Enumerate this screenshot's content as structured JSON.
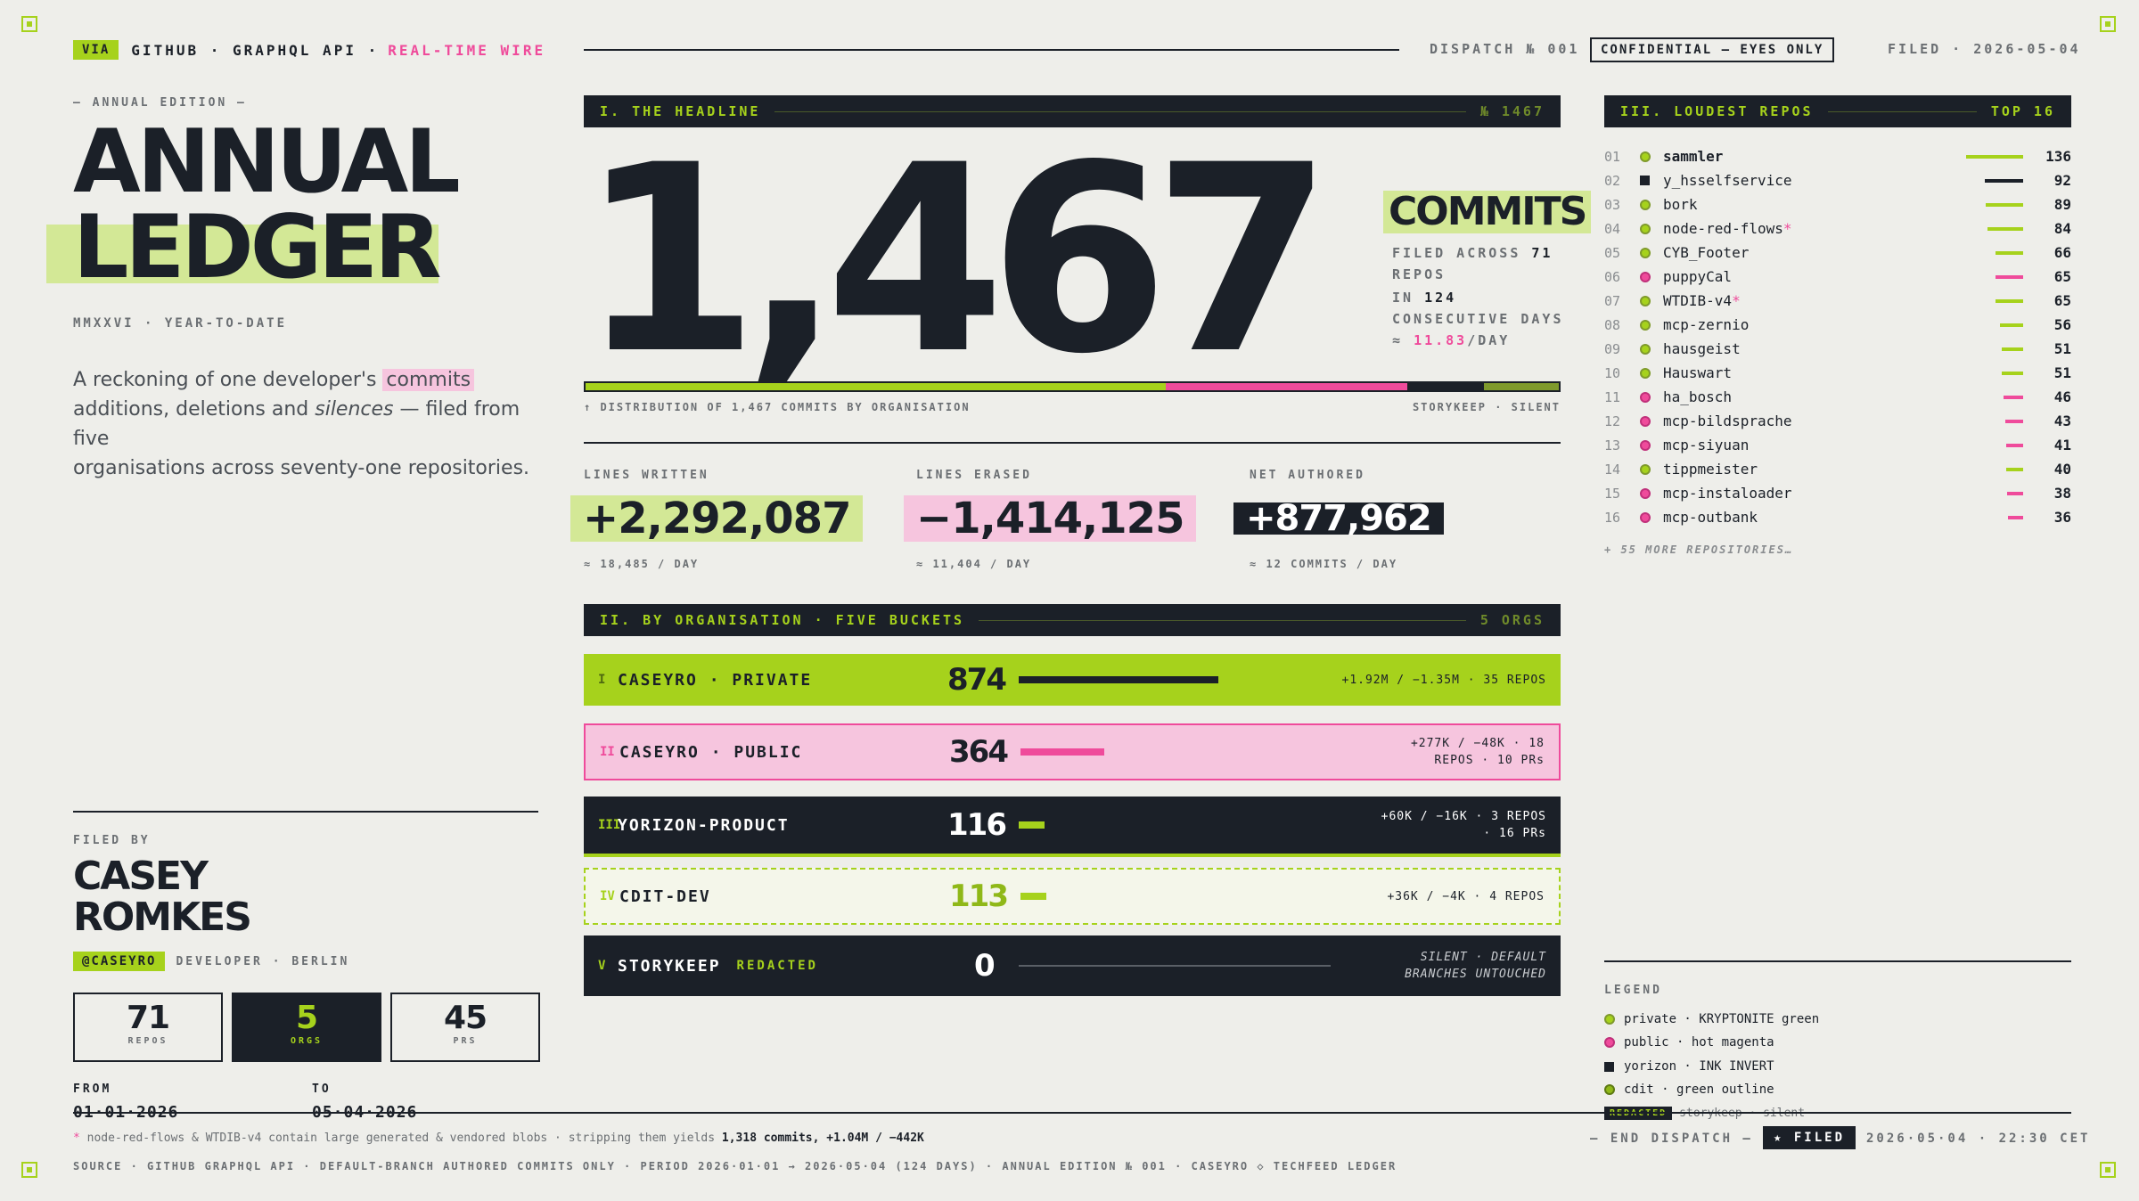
{
  "masthead": {
    "via": "VIA",
    "source": "GITHUB · GRAPHQL API ·",
    "wire": "REAL-TIME WIRE",
    "dispatch": "DISPATCH № 001",
    "confidential": "CONFIDENTIAL — EYES ONLY",
    "filed": "FILED · 2026-05-04"
  },
  "left": {
    "edition": "— ANNUAL EDITION —",
    "title_line1": "ANNUAL",
    "title_line2": "LEDGER",
    "subtitle": "MMXXVI · YEAR-TO-DATE",
    "intro_a": "A reckoning of one developer's",
    "intro_highlight": "commits",
    "intro_b": "additions, deletions and",
    "intro_em": "silences",
    "intro_c": "— filed from five",
    "intro_d": "organisations across seventy-one repositories.",
    "filed_by_label": "FILED BY",
    "name_line1": "CASEY",
    "name_line2": "ROMKES",
    "handle": "@CASEYRO",
    "role": "DEVELOPER · BERLIN",
    "stats": [
      {
        "n": "71",
        "l": "REPOS"
      },
      {
        "n": "5",
        "l": "ORGS"
      },
      {
        "n": "45",
        "l": "PRS"
      }
    ],
    "from_label": "FROM",
    "from_value": "01·01·2026",
    "to_label": "TO",
    "to_value": "05·04·2026"
  },
  "headline": {
    "section": "I. THE HEADLINE",
    "num": "№ 1467",
    "big": "1,467",
    "unit": "COMMITS",
    "filed_across_a": "FILED ACROSS",
    "filed_across_b": "71",
    "filed_across_c": "REPOS",
    "in_a": "IN",
    "in_b": "124",
    "in_c": "CONSECUTIVE DAYS",
    "rate_a": "≈",
    "rate_b": "11.83",
    "rate_c": "/DAY",
    "distribution_caption": "↑ DISTRIBUTION OF 1,467 COMMITS BY ORGANISATION",
    "distribution_right": "STORYKEEP · SILENT",
    "distribution": [
      {
        "org": "caseyro-private",
        "commits": 874,
        "color": "#a6d21c"
      },
      {
        "org": "caseyro-public",
        "commits": 364,
        "color": "#ef4b9b"
      },
      {
        "org": "yorizon-product",
        "commits": 116,
        "color": "#1b2028"
      },
      {
        "org": "cdit-dev",
        "commits": 113,
        "color": "#7f9a2c"
      }
    ]
  },
  "lines": {
    "written_label": "LINES WRITTEN",
    "written_value": "+2,292,087",
    "written_rate": "≈ 18,485 / DAY",
    "erased_label": "LINES ERASED",
    "erased_value": "−1,414,125",
    "erased_rate": "≈ 11,404 / DAY",
    "net_label": "NET AUTHORED",
    "net_value": "+877,962",
    "net_rate": "≈ 12 COMMITS / DAY"
  },
  "orgs": {
    "section": "II. BY ORGANISATION · FIVE BUCKETS",
    "count": "5 ORGS",
    "rows": [
      {
        "roman": "I",
        "name": "CASEYRO · PRIVATE",
        "tag": "",
        "commits": "874",
        "fill": 1.0,
        "meta": "+1.92M / −1.35M · 35 REPOS"
      },
      {
        "roman": "II",
        "name": "CASEYRO · PUBLIC",
        "tag": "",
        "commits": "364",
        "fill": 0.42,
        "meta": "+277K / −48K · 18 REPOS · 10 PRs"
      },
      {
        "roman": "III",
        "name": "YORIZON-PRODUCT",
        "tag": "",
        "commits": "116",
        "fill": 0.13,
        "meta": "+60K / −16K · 3 REPOS · 16 PRs"
      },
      {
        "roman": "IV",
        "name": "CDIT-DEV",
        "tag": "",
        "commits": "113",
        "fill": 0.13,
        "meta": "+36K / −4K · 4 REPOS"
      },
      {
        "roman": "V",
        "name": "STORYKEEP",
        "tag": "REDACTED",
        "commits": "0",
        "fill": 0,
        "meta": "SILENT · DEFAULT BRANCHES UNTOUCHED"
      }
    ]
  },
  "repos": {
    "section": "III. LOUDEST REPOS",
    "top": "TOP 16",
    "items": [
      {
        "idx": "01",
        "name": "sammler",
        "star": "",
        "kind": "private",
        "value": 136
      },
      {
        "idx": "02",
        "name": "y_hsselfservice",
        "star": "",
        "kind": "yorizon",
        "value": 92
      },
      {
        "idx": "03",
        "name": "bork",
        "star": "",
        "kind": "private",
        "value": 89
      },
      {
        "idx": "04",
        "name": "node-red-flows",
        "star": "*",
        "kind": "private",
        "value": 84
      },
      {
        "idx": "05",
        "name": "CYB_Footer",
        "star": "",
        "kind": "private",
        "value": 66
      },
      {
        "idx": "06",
        "name": "puppyCal",
        "star": "",
        "kind": "public",
        "value": 65
      },
      {
        "idx": "07",
        "name": "WTDIB-v4",
        "star": "*",
        "kind": "private",
        "value": 65
      },
      {
        "idx": "08",
        "name": "mcp-zernio",
        "star": "",
        "kind": "private",
        "value": 56
      },
      {
        "idx": "09",
        "name": "hausgeist",
        "star": "",
        "kind": "private",
        "value": 51
      },
      {
        "idx": "10",
        "name": "Hauswart",
        "star": "",
        "kind": "private",
        "value": 51
      },
      {
        "idx": "11",
        "name": "ha_bosch",
        "star": "",
        "kind": "public",
        "value": 46
      },
      {
        "idx": "12",
        "name": "mcp-bildsprache",
        "star": "",
        "kind": "public",
        "value": 43
      },
      {
        "idx": "13",
        "name": "mcp-siyuan",
        "star": "",
        "kind": "public",
        "value": 41
      },
      {
        "idx": "14",
        "name": "tippmeister",
        "star": "",
        "kind": "private",
        "value": 40
      },
      {
        "idx": "15",
        "name": "mcp-instaloader",
        "star": "",
        "kind": "public",
        "value": 38
      },
      {
        "idx": "16",
        "name": "mcp-outbank",
        "star": "",
        "kind": "public",
        "value": 36
      }
    ],
    "more": "+ 55 MORE REPOSITORIES…"
  },
  "legend": {
    "title": "LEGEND",
    "items": [
      {
        "label": "private · KRYPTONITE green",
        "color": "#a6d21c",
        "shape": "dot"
      },
      {
        "label": "public · hot magenta",
        "color": "#ef4b9b",
        "shape": "dot"
      },
      {
        "label": "yorizon · INK INVERT",
        "color": "#1b2028",
        "shape": "square"
      },
      {
        "label": "cdit · green outline",
        "color": "#7f9a2c",
        "shape": "dot"
      }
    ],
    "redacted_tag": "REDACTED",
    "redacted_label": "storykeep · silent"
  },
  "footer": {
    "note_star": "*",
    "note_a": "node-red-flows & WTDIB-v4 contain large generated & vendored blobs · stripping them yields",
    "note_b": "1,318 commits, +1.04M / −442K",
    "end": "— END DISPATCH —",
    "filed_tag": "★ FILED",
    "timestamp": "2026·05·04 · 22:30 CET",
    "source_line": "SOURCE · GITHUB GRAPHQL API · DEFAULT-BRANCH AUTHORED COMMITS ONLY · PERIOD 2026·01·01 → 2026·05·04 (124 DAYS) · ANNUAL EDITION № 001 · CASEYRO ◇ TECHFEED LEDGER"
  },
  "colors": {
    "ink": "#1b2028",
    "lime": "#a6d21c",
    "magenta": "#ef4b9b",
    "paper": "#eeeeea",
    "olive": "#7f9a2c"
  }
}
